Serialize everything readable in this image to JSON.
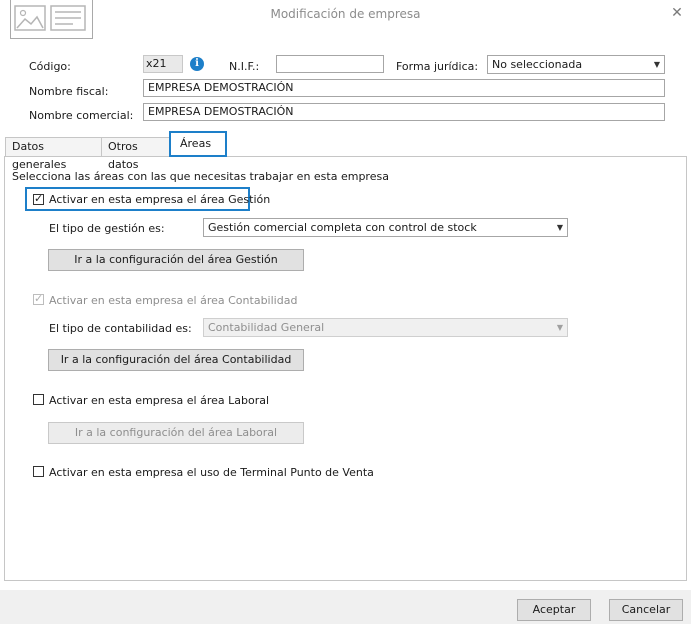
{
  "window": {
    "title": "Modificación de empresa",
    "close_glyph": "✕"
  },
  "header": {
    "codigo_label": "Código:",
    "codigo_value": "x21",
    "info_glyph": "i",
    "nif_label": "N.I.F.:",
    "nif_value": "",
    "forma_label": "Forma jurídica:",
    "forma_value": "No seleccionada",
    "fiscal_label": "Nombre fiscal:",
    "fiscal_value": "EMPRESA DEMOSTRACIÓN",
    "comercial_label": "Nombre comercial:",
    "comercial_value": "EMPRESA DEMOSTRACIÓN"
  },
  "tabs": [
    {
      "label": "Datos generales"
    },
    {
      "label": "Otros datos"
    },
    {
      "label": "Áreas"
    }
  ],
  "areas": {
    "intro": "Selecciona las áreas con las que necesitas trabajar en esta empresa",
    "gestion": {
      "check_label": "Activar en esta empresa el área Gestión",
      "type_label": "El tipo de gestión es:",
      "type_value": "Gestión comercial completa con control de stock",
      "config_button": "Ir a la configuración del área Gestión"
    },
    "contabilidad": {
      "check_label": "Activar en esta empresa el área Contabilidad",
      "type_label": "El tipo de contabilidad es:",
      "type_value": "Contabilidad General",
      "config_button": "Ir a la configuración del área Contabilidad"
    },
    "laboral": {
      "check_label": "Activar en esta empresa el área Laboral",
      "config_button": "Ir a la configuración del área Laboral"
    },
    "tpv": {
      "check_label": "Activar en esta empresa el uso de Terminal Punto de Venta"
    }
  },
  "footer": {
    "accept": "Aceptar",
    "cancel": "Cancelar"
  },
  "icons": {
    "arrow": "▼"
  },
  "colors": {
    "accent": "#1d7fc9"
  }
}
